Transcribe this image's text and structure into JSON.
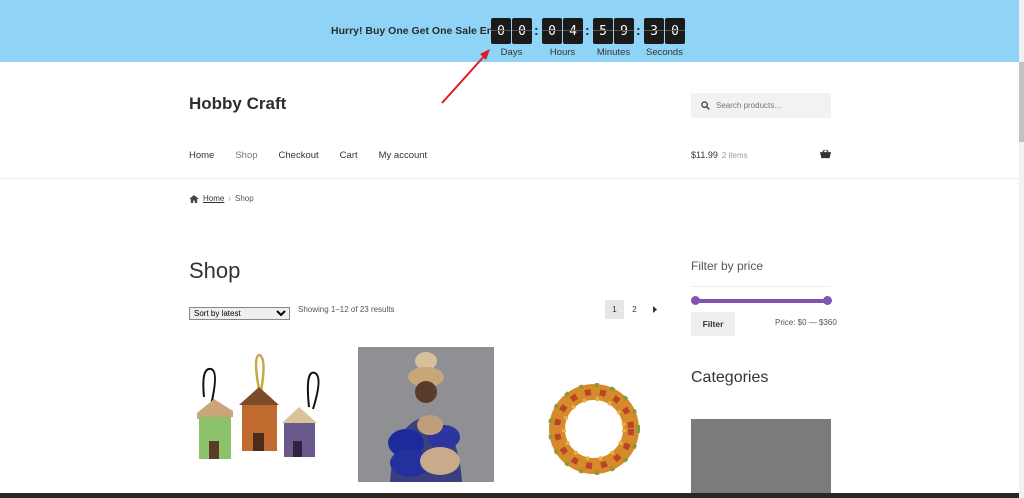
{
  "countdown": {
    "message": "Hurry! Buy One Get One Sale Ends in",
    "units": [
      {
        "digits": [
          "0",
          "0"
        ],
        "label": "Days"
      },
      {
        "digits": [
          "0",
          "4"
        ],
        "label": "Hours"
      },
      {
        "digits": [
          "5",
          "9"
        ],
        "label": "Minutes"
      },
      {
        "digits": [
          "3",
          "0"
        ],
        "label": "Seconds"
      }
    ],
    "colors": {
      "bar": "#8fd3f7",
      "digit_bg": "#1a1a1a",
      "annotation_arrow": "#e0191f"
    }
  },
  "header": {
    "site_title": "Hobby Craft",
    "search_placeholder": "Search products…",
    "nav": [
      "Home",
      "Shop",
      "Checkout",
      "Cart",
      "My account"
    ],
    "active_nav": "Shop",
    "cart_total": "$11.99",
    "cart_items": "2 items"
  },
  "breadcrumb": {
    "home": "Home",
    "current": "Shop"
  },
  "main": {
    "page_title": "Shop",
    "sort_selected": "Sort by latest",
    "result_count": "Showing 1–12 of 23 results",
    "pages": [
      "1",
      "2"
    ],
    "current_page": "1",
    "next_icon": "chevron-right-icon"
  },
  "sidebar": {
    "filter_title": "Filter by price",
    "filter_button": "Filter",
    "price_range": "Price: $0 — $360",
    "categories_title": "Categories",
    "accent": "#7f54b3"
  }
}
